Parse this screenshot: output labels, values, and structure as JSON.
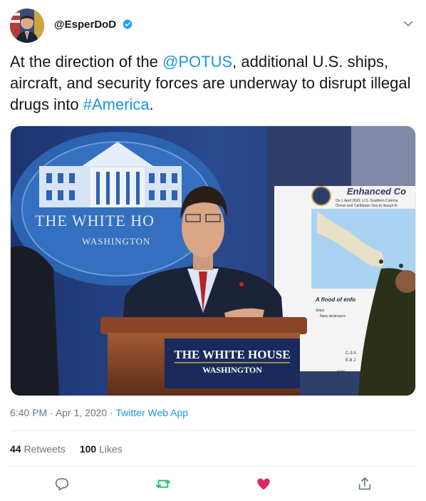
{
  "user": {
    "handle": "@EsperDoD",
    "verified": true
  },
  "tweet": {
    "text_1": "At the direction of the ",
    "mention": "@POTUS",
    "text_2": ", additional U.S. ships, aircraft, and security forces are underway to disrupt illegal drugs into ",
    "hashtag": "#America",
    "text_3": "."
  },
  "media": {
    "seal_line1": "THE WHITE HO",
    "seal_line2": "WASHINGTON",
    "podium_line1": "THE WHITE HOUSE",
    "podium_line2": "WASHINGTON",
    "poster_title": "Enhanced Co",
    "poster_caption_1": "On 1 April 2020, U.S. Southern Comma",
    "poster_caption_2": "Ocean and Caribbean Sea to disrupt th",
    "poster_subhead": "A flood of enfo",
    "poster_ships": "Ships",
    "poster_bullet": "Navy destroyers",
    "poster_misc_1": "C-3 A",
    "poster_misc_2": "E-8 J",
    "poster_misc_3": "rces"
  },
  "meta": {
    "time": "6:40 PM",
    "sep1": " · ",
    "date": "Apr 1, 2020",
    "sep2": " · ",
    "source": "Twitter Web App"
  },
  "stats": {
    "retweets_count": "44",
    "retweets_label": " Retweets",
    "likes_count": "100",
    "likes_label": " Likes"
  },
  "colors": {
    "link": "#1b95e0",
    "meta": "#657786",
    "retweet_active": "#17bf63",
    "like_active": "#e0245e",
    "divider": "#e6ecf0"
  },
  "icons": [
    "verified-badge-icon",
    "chevron-down-icon",
    "reply-icon",
    "retweet-icon",
    "like-icon",
    "share-icon"
  ]
}
